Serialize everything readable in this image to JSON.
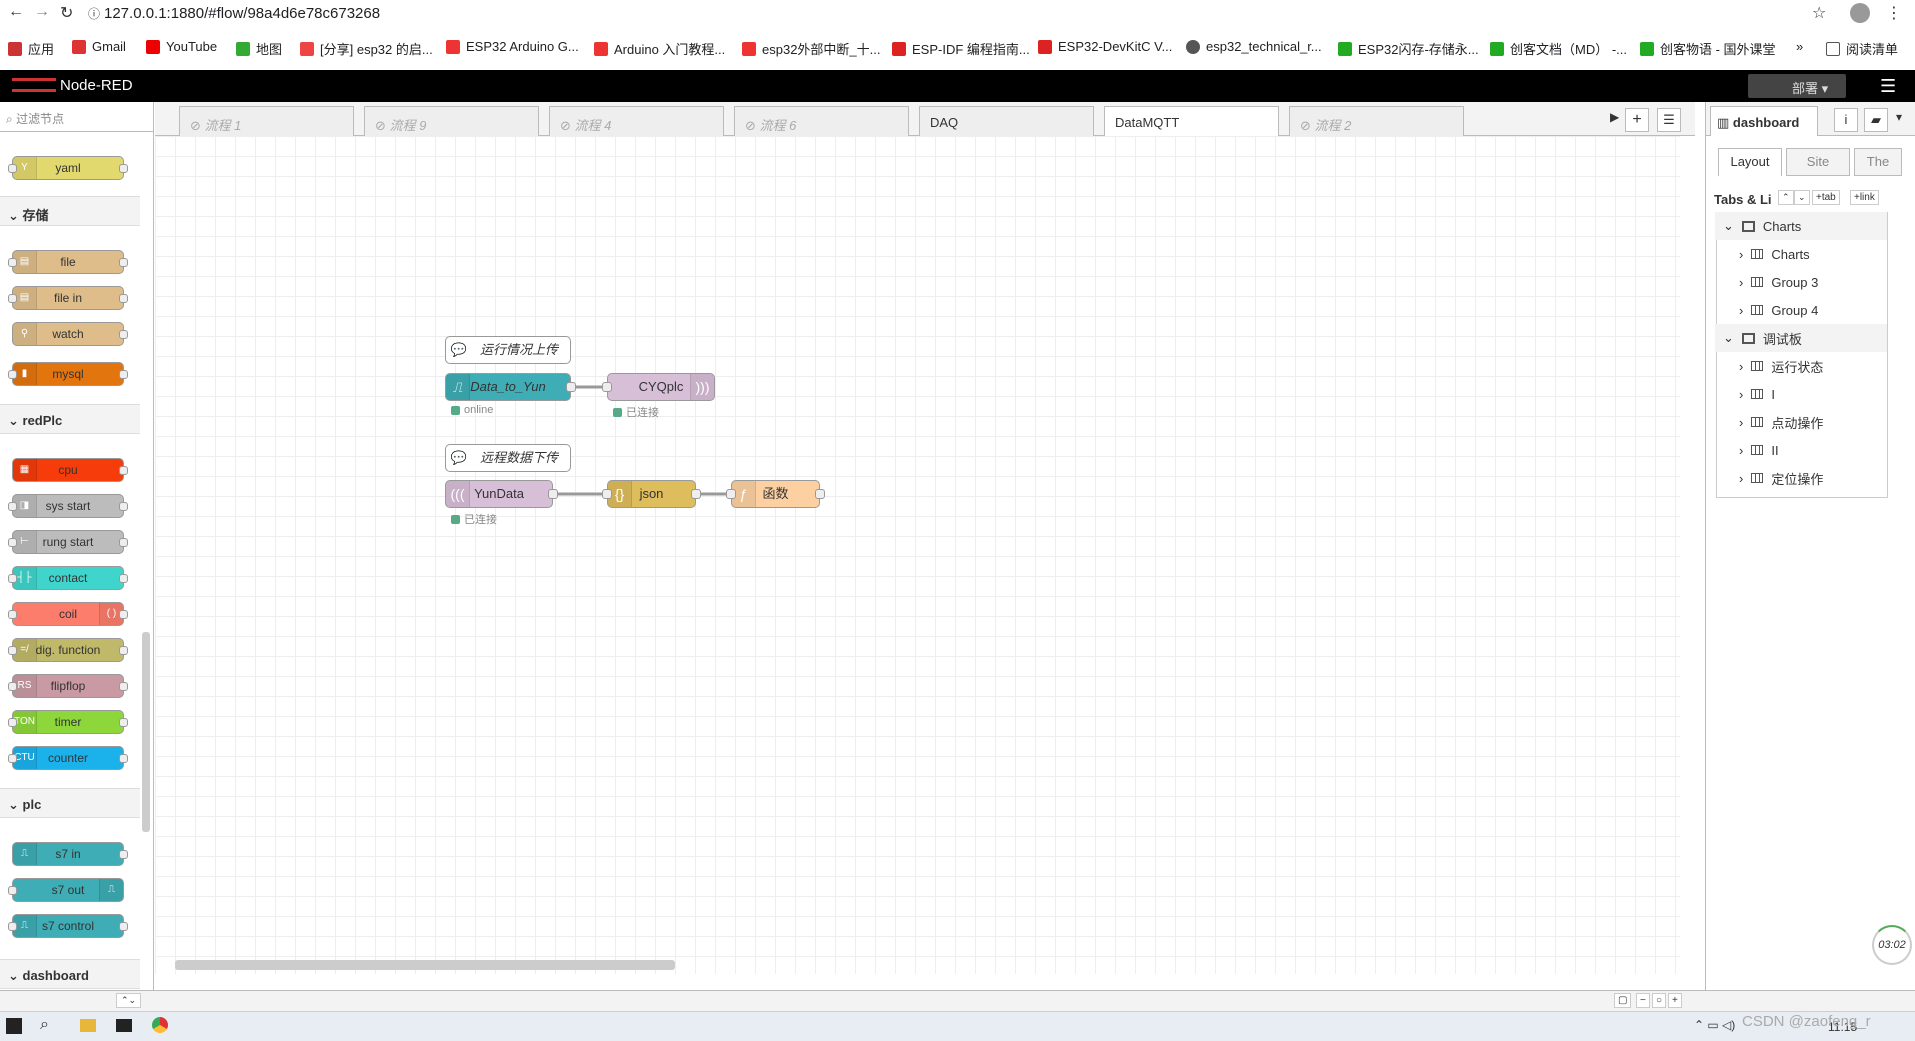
{
  "browser": {
    "url": "127.0.0.1:1880/#flow/98a4d6e78c673268"
  },
  "bookmarks": [
    "应用",
    "Gmail",
    "YouTube",
    "地图",
    "[分享] esp32 的启...",
    "ESP32 Arduino G...",
    "Arduino 入门教程...",
    "esp32外部中断_十...",
    "ESP-IDF 编程指南...",
    "ESP32-DevKitC V...",
    "esp32_technical_r...",
    "ESP32闪存-存储永...",
    "创客文档（MD） -...",
    "创客物语 - 国外课堂",
    "阅读清单"
  ],
  "header": {
    "title": "Node-RED",
    "deploy": "部署"
  },
  "palette": {
    "filter_placeholder": "过滤节点",
    "categories": {
      "storage": "存储",
      "redplc": "redPlc",
      "plc": "plc",
      "dashboard": "dashboard"
    },
    "nodes": {
      "yaml": "yaml",
      "file": "file",
      "file_in": "file in",
      "watch": "watch",
      "mysql": "mysql",
      "cpu": "cpu",
      "sys_start": "sys start",
      "rung_start": "rung start",
      "contact": "contact",
      "coil": "coil",
      "dig_function": "dig. function",
      "flipflop": "flipflop",
      "timer": "timer",
      "counter": "counter",
      "s7_in": "s7 in",
      "s7_out": "s7 out",
      "s7_control": "s7 control"
    }
  },
  "tabs": [
    "流程 1",
    "流程 9",
    "流程 4",
    "流程 6",
    "DAQ",
    "DataMQTT",
    "流程 2"
  ],
  "flow": {
    "comment1": "运行情况上传",
    "node_data_to_yun": "Data_to_Yun",
    "node_cyqplc": "CYQplc",
    "status_online": "online",
    "status_connected": "已连接",
    "comment2": "远程数据下传",
    "node_yundata": "YunData",
    "node_json": "json",
    "node_func": "函数"
  },
  "sidebar": {
    "title": "dashboard",
    "tab_layout": "Layout",
    "tab_site": "Site",
    "tab_theme": "The",
    "tabs_links": "Tabs & Li",
    "btn_tab": "+tab",
    "btn_link": "+link",
    "tree": [
      {
        "label": "Charts",
        "top": true
      },
      {
        "label": "Charts"
      },
      {
        "label": "Group 3"
      },
      {
        "label": "Group 4"
      },
      {
        "label": "调试板",
        "top": true
      },
      {
        "label": "运行状态"
      },
      {
        "label": "I"
      },
      {
        "label": "点动操作"
      },
      {
        "label": "II"
      },
      {
        "label": "定位操作"
      }
    ]
  },
  "clock": "03:02",
  "taskbar": {
    "time": "11:15",
    "watermark": "CSDN @zaofeng_r"
  }
}
